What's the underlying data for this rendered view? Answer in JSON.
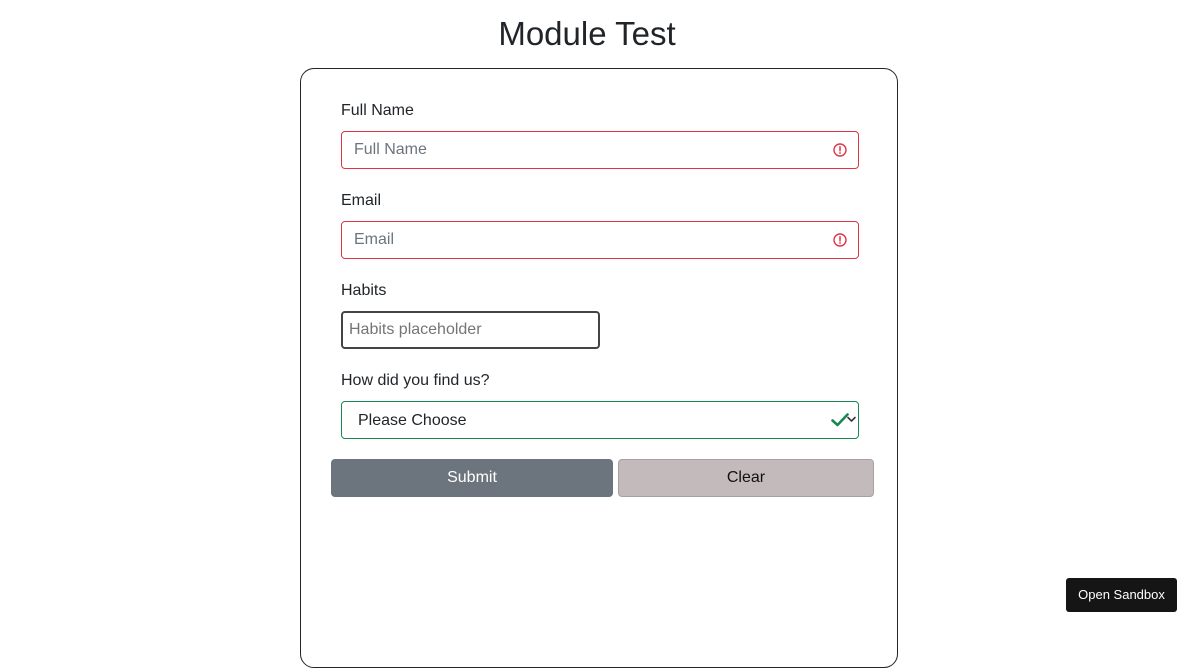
{
  "page": {
    "title": "Module Test"
  },
  "form": {
    "full_name": {
      "label": "Full Name",
      "value": "",
      "placeholder": "Full Name",
      "state": "invalid"
    },
    "email": {
      "label": "Email",
      "value": "",
      "placeholder": "Email",
      "state": "invalid"
    },
    "habits": {
      "label": "Habits",
      "value": "",
      "placeholder": "Habits placeholder",
      "state": "focused"
    },
    "source": {
      "label": "How did you find us?",
      "selected": "Please Choose",
      "state": "valid"
    },
    "submit_label": "Submit",
    "clear_label": "Clear"
  },
  "sandbox": {
    "label": "Open Sandbox"
  },
  "icons": {
    "invalid": "exclamation-circle-icon",
    "valid": "check-icon",
    "dropdown": "chevron-down-icon"
  },
  "colors": {
    "invalid": "#dc3545",
    "valid": "#198754",
    "submit_bg": "#6c757d",
    "clear_bg": "#c3babb",
    "sandbox_bg": "#151515"
  }
}
